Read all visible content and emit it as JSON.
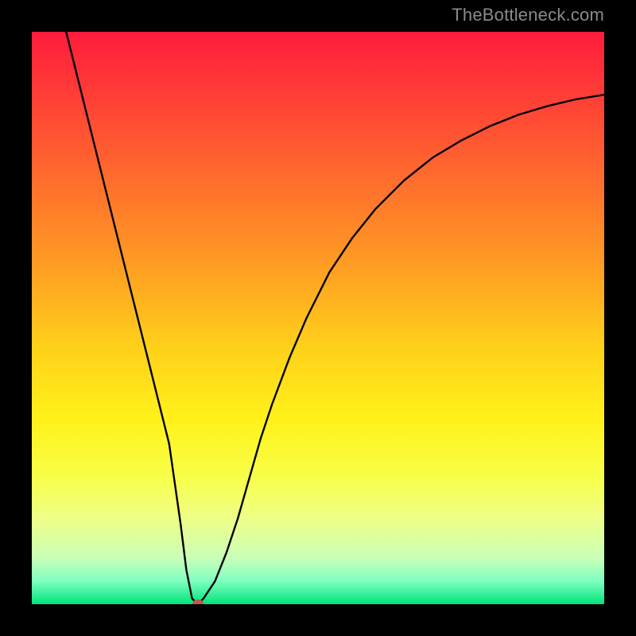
{
  "watermark": "TheBottleneck.com",
  "colors": {
    "frame": "#000000",
    "watermark": "#8a8a8a",
    "curve": "#000000",
    "vertex_dot": "#c0594e"
  },
  "gradient_stops": [
    {
      "pct": 0,
      "color": "#ff1c3c"
    },
    {
      "pct": 10,
      "color": "#ff3a37"
    },
    {
      "pct": 25,
      "color": "#ff6a2e"
    },
    {
      "pct": 40,
      "color": "#ff9a23"
    },
    {
      "pct": 55,
      "color": "#ffd01a"
    },
    {
      "pct": 68,
      "color": "#fff21a"
    },
    {
      "pct": 78,
      "color": "#f8ff4a"
    },
    {
      "pct": 85,
      "color": "#efff88"
    },
    {
      "pct": 92,
      "color": "#c8ffb8"
    },
    {
      "pct": 96,
      "color": "#7dffc0"
    },
    {
      "pct": 100,
      "color": "#00e47a"
    }
  ],
  "chart_data": {
    "type": "line",
    "title": "",
    "xlabel": "",
    "ylabel": "",
    "xlim": [
      0,
      100
    ],
    "ylim": [
      0,
      100
    ],
    "vertex": {
      "x": 29,
      "y": 0
    },
    "series": [
      {
        "name": "bottleneck-curve",
        "x": [
          6,
          8,
          10,
          12,
          14,
          16,
          18,
          20,
          22,
          24,
          26,
          27,
          28,
          29,
          30,
          32,
          34,
          36,
          38,
          40,
          42,
          45,
          48,
          52,
          56,
          60,
          65,
          70,
          75,
          80,
          85,
          90,
          95,
          100
        ],
        "y": [
          100,
          92,
          84,
          76,
          68,
          60,
          52,
          44,
          36,
          28,
          14,
          6,
          1,
          0,
          1,
          4,
          9,
          15,
          22,
          29,
          35,
          43,
          50,
          58,
          64,
          69,
          74,
          78,
          81,
          83.5,
          85.5,
          87,
          88.2,
          89
        ]
      }
    ],
    "annotations": [
      {
        "kind": "dot",
        "x": 29,
        "y": 0
      }
    ]
  }
}
